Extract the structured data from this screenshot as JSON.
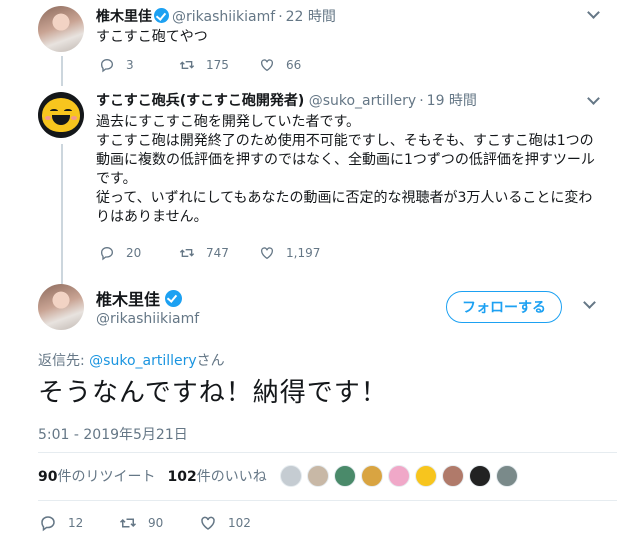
{
  "tweet1": {
    "name": "椎木里佳",
    "handle": "@rikashiikiamf",
    "time": "22 時間",
    "text": "すこすこ砲てやつ",
    "replies": "3",
    "retweets": "175",
    "likes": "66"
  },
  "tweet2": {
    "name": "すこすこ砲兵(すこすこ砲開発者)",
    "handle": "@suko_artillery",
    "time": "19 時間",
    "text_lines": [
      "過去にすこすこ砲を開発していた者です。",
      "すこすこ砲は開発終了のため使用不可能ですし、そもそも、すこすこ砲は1つの",
      "動画に複数の低評価を押すのではなく、全動画に1つずつの低評価を押すツール",
      "です。",
      "従って、いずれにしてもあなたの動画に否定的な視聴者が3万人いることに変わ",
      "りはありません。"
    ],
    "replies": "20",
    "retweets": "747",
    "likes": "1,197"
  },
  "main": {
    "name": "椎木里佳",
    "handle": "@rikashiikiamf",
    "follow_label": "フォローする",
    "reply_prefix": "返信先: ",
    "reply_mention": "@suko_artillery",
    "reply_suffix": "さん",
    "text": "そうなんですね！納得です！",
    "timestamp": "5:01 - 2019年5月21日",
    "retweet_count": "90",
    "retweet_label": "件のリツイート",
    "like_count": "102",
    "like_label": "件のいいね",
    "replies": "12",
    "retweets": "90",
    "likes": "102"
  },
  "likers": [
    "#c5ccd2",
    "#c8b8a6",
    "#4a8a6a",
    "#d9a441",
    "#f0a8c8",
    "#f7c51e",
    "#b07a6a",
    "#222222",
    "#7a8a8a"
  ],
  "colors": {
    "accent": "#1da1f2",
    "muted": "#657786",
    "text": "#14171a"
  }
}
